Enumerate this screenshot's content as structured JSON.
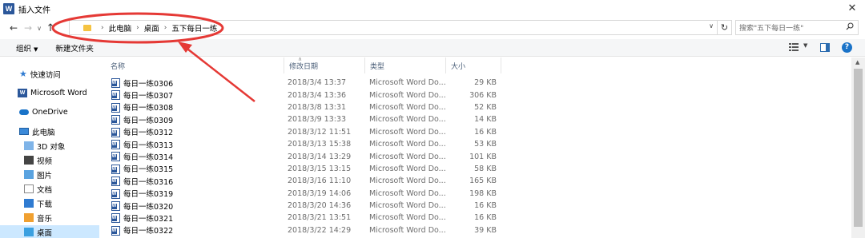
{
  "window": {
    "app_icon": "W",
    "title": "插入文件",
    "close_glyph": "✕"
  },
  "navigation": {
    "back": "←",
    "forward": "→",
    "recent": "∨",
    "up": "↑",
    "refresh": "↻",
    "dropdown": "∨",
    "breadcrumb": [
      "此电脑",
      "桌面",
      "五下每日一练"
    ],
    "separator": "›"
  },
  "search": {
    "placeholder": "搜索\"五下每日一练\"",
    "icon": "search-icon"
  },
  "toolbar": {
    "organize_label": "组织",
    "organize_caret": "▼",
    "new_folder_label": "新建文件夹",
    "help_glyph": "?"
  },
  "sidebar": {
    "items": [
      {
        "label": "快速访问",
        "icon": "star-icon"
      },
      {
        "label": "Microsoft Word",
        "icon": "word-icon"
      },
      {
        "label": "OneDrive",
        "icon": "cloud-icon"
      },
      {
        "label": "此电脑",
        "icon": "computer-icon"
      },
      {
        "label": "3D 对象",
        "icon": "3d-objects-icon"
      },
      {
        "label": "视频",
        "icon": "video-icon"
      },
      {
        "label": "图片",
        "icon": "pictures-icon"
      },
      {
        "label": "文档",
        "icon": "documents-icon"
      },
      {
        "label": "下载",
        "icon": "download-icon"
      },
      {
        "label": "音乐",
        "icon": "music-icon"
      },
      {
        "label": "桌面",
        "icon": "desktop-icon"
      }
    ]
  },
  "columns": {
    "name": "名称",
    "date": "修改日期",
    "type": "类型",
    "size": "大小"
  },
  "files": [
    {
      "name": "每日一练0306",
      "date": "2018/3/4 13:37",
      "type": "Microsoft Word Do...",
      "size": "29 KB"
    },
    {
      "name": "每日一练0307",
      "date": "2018/3/4 13:36",
      "type": "Microsoft Word Do...",
      "size": "306 KB"
    },
    {
      "name": "每日一练0308",
      "date": "2018/3/8 13:31",
      "type": "Microsoft Word Do...",
      "size": "52 KB"
    },
    {
      "name": "每日一练0309",
      "date": "2018/3/9 13:33",
      "type": "Microsoft Word Do...",
      "size": "14 KB"
    },
    {
      "name": "每日一练0312",
      "date": "2018/3/12 11:51",
      "type": "Microsoft Word Do...",
      "size": "16 KB"
    },
    {
      "name": "每日一练0313",
      "date": "2018/3/13 15:38",
      "type": "Microsoft Word Do...",
      "size": "53 KB"
    },
    {
      "name": "每日一练0314",
      "date": "2018/3/14 13:29",
      "type": "Microsoft Word Do...",
      "size": "101 KB"
    },
    {
      "name": "每日一练0315",
      "date": "2018/3/15 13:15",
      "type": "Microsoft Word Do...",
      "size": "58 KB"
    },
    {
      "name": "每日一练0316",
      "date": "2018/3/16 11:10",
      "type": "Microsoft Word Do...",
      "size": "165 KB"
    },
    {
      "name": "每日一练0319",
      "date": "2018/3/19 14:06",
      "type": "Microsoft Word Do...",
      "size": "198 KB"
    },
    {
      "name": "每日一练0320",
      "date": "2018/3/20 14:36",
      "type": "Microsoft Word Do...",
      "size": "16 KB"
    },
    {
      "name": "每日一练0321",
      "date": "2018/3/21 13:51",
      "type": "Microsoft Word Do...",
      "size": "16 KB"
    },
    {
      "name": "每日一练0322",
      "date": "2018/3/22 14:29",
      "type": "Microsoft Word Do...",
      "size": "39 KB"
    }
  ],
  "colors": {
    "annotation": "#e53935",
    "selection": "#cce8ff",
    "word_blue": "#2b579a"
  }
}
